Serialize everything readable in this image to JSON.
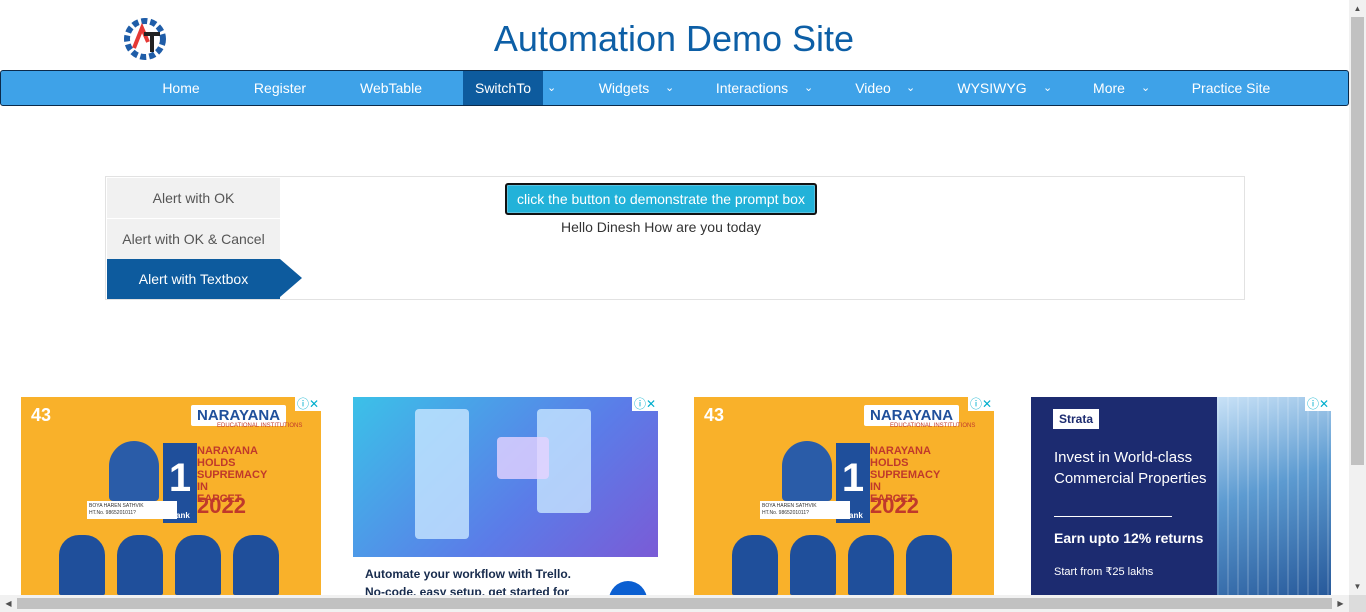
{
  "site": {
    "title": "Automation Demo Site",
    "logo_icon": "gear-logo-icon"
  },
  "nav": {
    "items": [
      {
        "label": "Home"
      },
      {
        "label": "Register"
      },
      {
        "label": "WebTable"
      },
      {
        "label": "SwitchTo",
        "active": true
      },
      {
        "label": "Widgets"
      },
      {
        "label": "Interactions"
      },
      {
        "label": "Video"
      },
      {
        "label": "WYSIWYG"
      },
      {
        "label": "More"
      },
      {
        "label": "Practice Site"
      }
    ],
    "caret": "⌄"
  },
  "alerts": {
    "tabs": [
      {
        "label": "Alert with OK"
      },
      {
        "label": "Alert with OK & Cancel"
      },
      {
        "label": "Alert with Textbox",
        "active": true
      }
    ],
    "button_label": "click the button to demonstrate the prompt box",
    "result_text": "Hello Dinesh How are you today"
  },
  "ads": {
    "close_glyph": "ⓘ✕",
    "narayana": {
      "logo": "NARAYANA",
      "sub": "EDUCATIONAL INSTITUTIONS",
      "years": "43",
      "headline": [
        "NARAYANA",
        "HOLDS",
        "SUPREMACY",
        "IN",
        "EAPCET"
      ],
      "year": "2022",
      "rank_number": "1",
      "rank_label": "Rank",
      "student_name": "BOYA HAREN SATHVIK",
      "ht_no": "HT.No. 9865201011?"
    },
    "trello": {
      "line1": "Automate your workflow with Trello.",
      "line2": "No-code, easy setup, get started for"
    },
    "strata": {
      "logo": "Strata",
      "headline": "Invest in World-class Commercial Properties",
      "returns": "Earn upto 12% returns",
      "start": "Start from ₹25 lakhs"
    }
  },
  "colors": {
    "nav_bg": "#3ea2e8",
    "nav_active": "#0d5b9e",
    "title": "#0d5fa6",
    "button": "#22b2d9"
  }
}
